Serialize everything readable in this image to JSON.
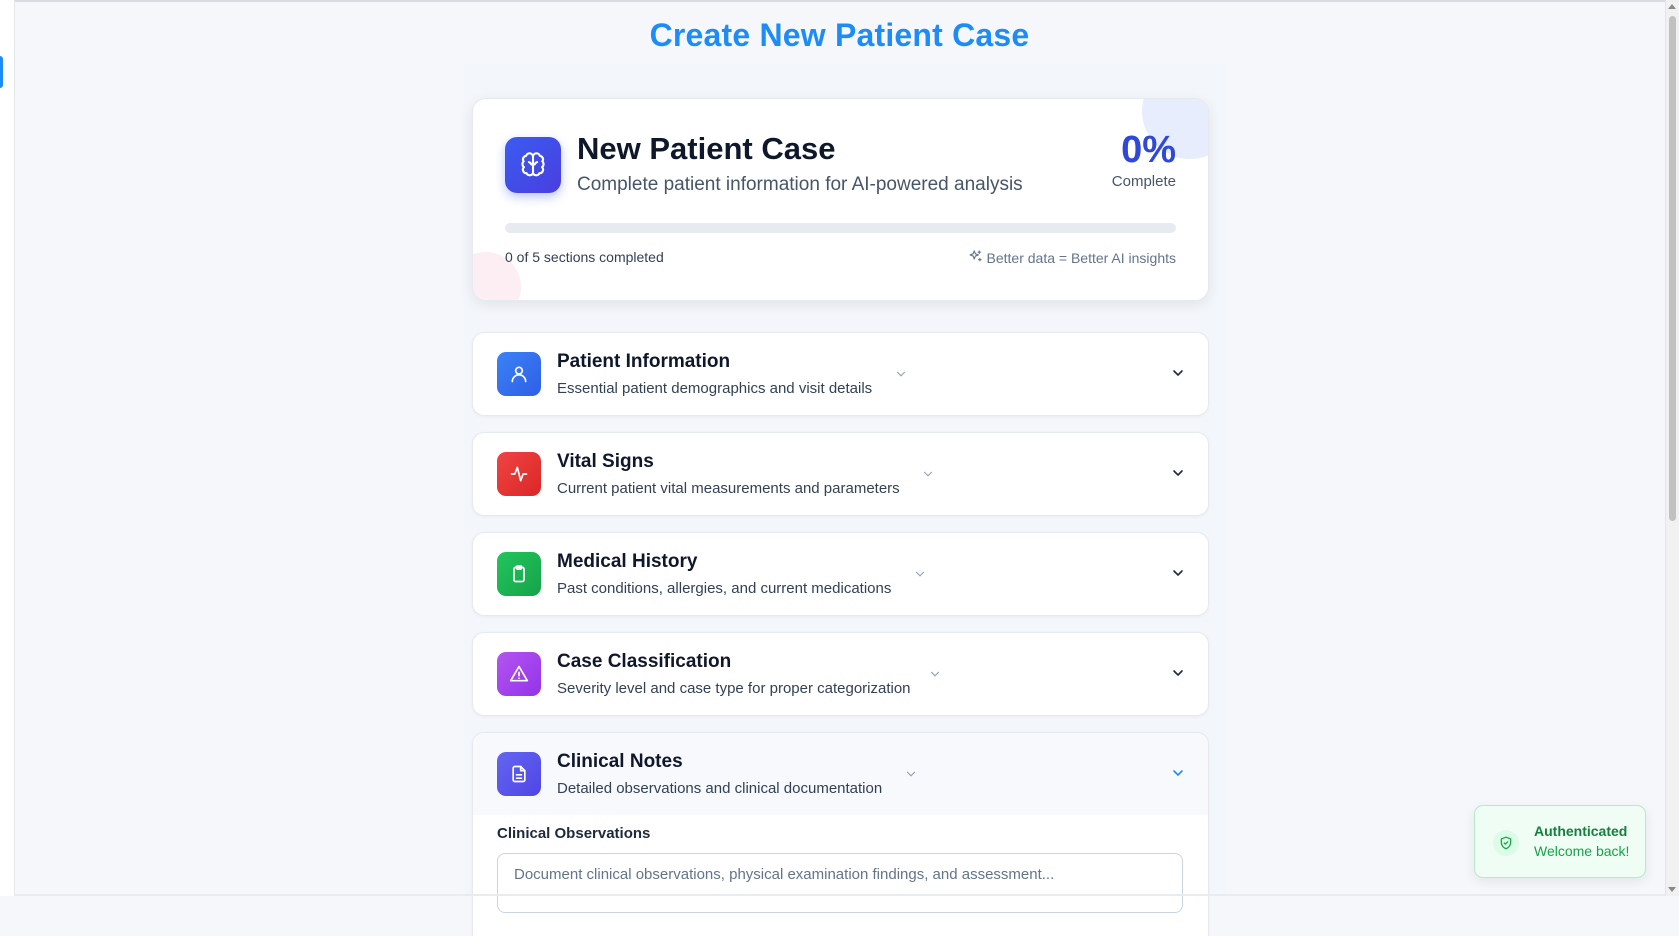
{
  "page": {
    "title": "Create New Patient Case"
  },
  "summary": {
    "title": "New Patient Case",
    "subtitle": "Complete patient information for AI-powered analysis",
    "percent": "0%",
    "percent_label": "Complete",
    "progress_fraction": 0,
    "sections_completed": "0 of 5 sections completed",
    "insight": "Better data = Better AI insights",
    "icon": "brain-icon"
  },
  "sections": [
    {
      "title": "Patient Information",
      "description": "Essential patient demographics and visit details",
      "icon": "user-icon",
      "color": "#3b6ff5",
      "expanded": false
    },
    {
      "title": "Vital Signs",
      "description": "Current patient vital measurements and parameters",
      "icon": "activity-icon",
      "color": "#e5322f",
      "expanded": false
    },
    {
      "title": "Medical History",
      "description": "Past conditions, allergies, and current medications",
      "icon": "clipboard-icon",
      "color": "#1fae4c",
      "expanded": false
    },
    {
      "title": "Case Classification",
      "description": "Severity level and case type for proper categorization",
      "icon": "alert-triangle-icon",
      "color": "#a247e8",
      "expanded": false
    },
    {
      "title": "Clinical Notes",
      "description": "Detailed observations and clinical documentation",
      "icon": "file-text-icon",
      "color": "#5b54e6",
      "expanded": true
    }
  ],
  "clinical_notes": {
    "observations_label": "Clinical Observations",
    "observations_placeholder": "Document clinical observations, physical examination findings, and assessment..."
  },
  "toast": {
    "title": "Authenticated",
    "message": "Welcome back!",
    "icon": "shield-check-icon"
  },
  "colors": {
    "accent": "#1d8cf8",
    "primary": "#3a5cf0",
    "success": "#16a34a"
  }
}
